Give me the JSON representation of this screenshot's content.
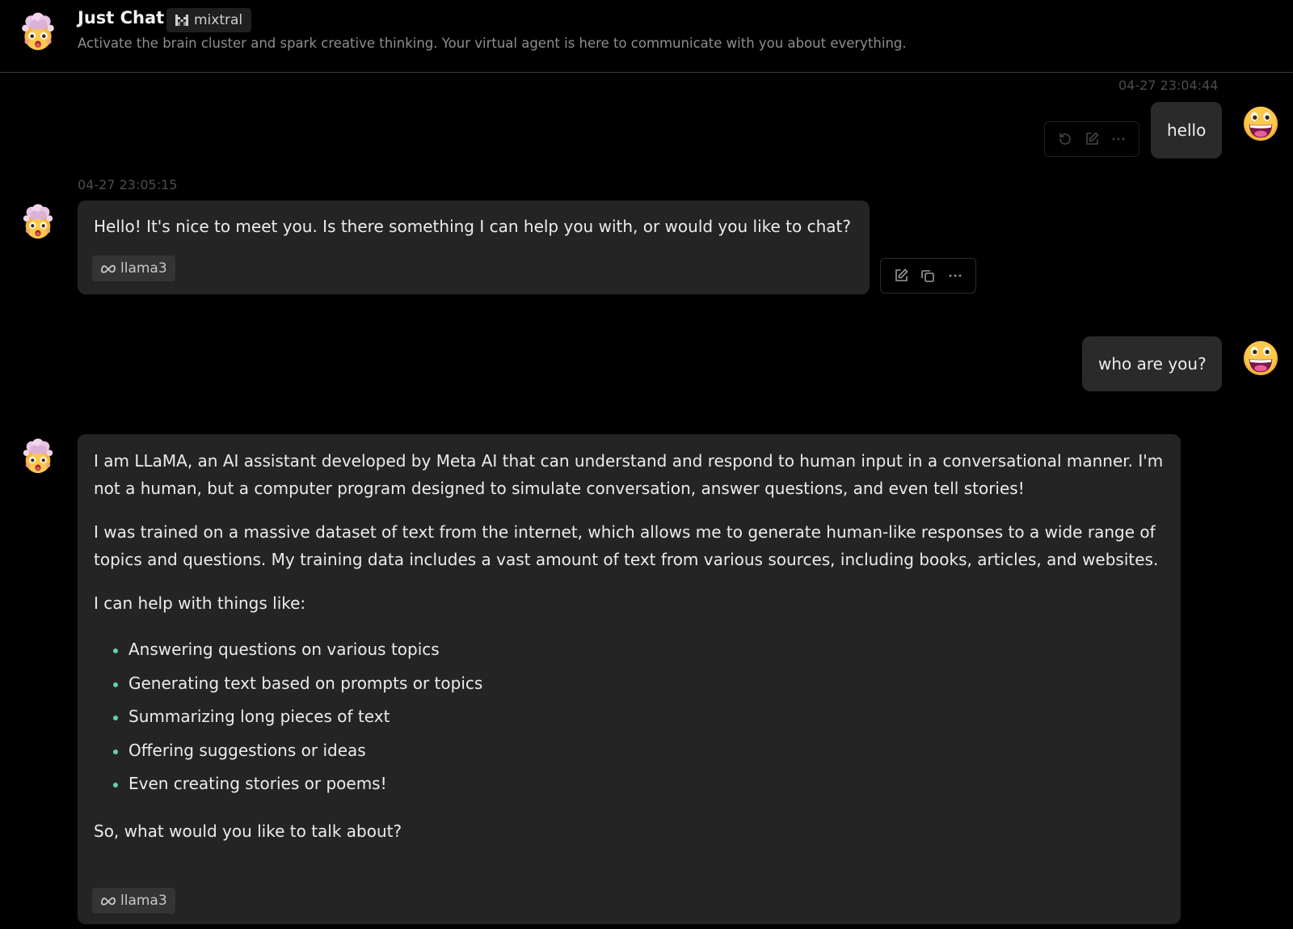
{
  "header": {
    "title": "Just Chat",
    "model": "mixtral",
    "description": "Activate the brain cluster and spark creative thinking. Your virtual agent is here to communicate with you about everything."
  },
  "messages": {
    "m1": {
      "time": "04-27 23:04:44",
      "text": "hello"
    },
    "m2": {
      "time": "04-27 23:05:15",
      "text": "Hello! It's nice to meet you. Is there something I can help you with, or would you like to chat?",
      "model": "llama3"
    },
    "m3": {
      "text": "who are you?"
    },
    "m4": {
      "p1": "I am LLaMA, an AI assistant developed by Meta AI that can understand and respond to human input in a conversational manner. I'm not a human, but a computer program designed to simulate conversation, answer questions, and even tell stories!",
      "p2": "I was trained on a massive dataset of text from the internet, which allows me to generate human-like responses to a wide range of topics and questions. My training data includes a vast amount of text from various sources, including books, articles, and websites.",
      "p3": "I can help with things like:",
      "bullets": [
        "Answering questions on various topics",
        "Generating text based on prompts or topics",
        "Summarizing long pieces of text",
        "Offering suggestions or ideas",
        "Even creating stories or poems!"
      ],
      "p4": "So, what would you like to talk about?",
      "model": "llama3"
    }
  },
  "icons": {
    "assistant_avatar": "exploding-head-emoji",
    "user_avatar": "grinning-face-emoji",
    "model_tag_icon": "mistral-logo-icon",
    "llama_tag_icon": "meta-logo-icon"
  },
  "colors": {
    "background": "#000000",
    "bubble": "#242424",
    "bullet": "#5fd3b0"
  }
}
